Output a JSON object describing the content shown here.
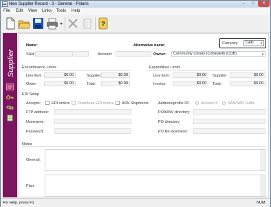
{
  "window": {
    "title": "New Supplier Record - 3 - General - Polaris",
    "min_glyph": "–",
    "max_glyph": "□",
    "close_glyph": "✕"
  },
  "menu": [
    "File",
    "Edit",
    "View",
    "Links",
    "Tools",
    "Help"
  ],
  "toolbar_icons": [
    "new-document-icon",
    "open-folder-icon",
    "save-disk-icon",
    "print-icon",
    "delete-x-icon",
    "copy-icon",
    "help-icon"
  ],
  "sidebar": {
    "title": "Supplier",
    "icons": [
      "supplier-record-icon",
      "key-icon",
      "link-icon",
      "notes-icon"
    ],
    "color": "#7a1560"
  },
  "form": {
    "name_label": "Name:",
    "name_value": "",
    "alt_name_label": "Alternative name:",
    "alt_name_value": "",
    "currency_label": "Currency:",
    "currency_value": "CAD",
    "san_label": "SAN:",
    "san_value": "",
    "san_suffix": "",
    "account_label": "Account:",
    "account_value": "",
    "owner_label": "Owner:",
    "owner_value": "Community Library (Cobleskill) (COB)"
  },
  "encumbrance": {
    "title": "Encumbrance Limits",
    "line_item_label": "Line item:",
    "line_item_value": "$0.00",
    "supplier_label": "Supplier:",
    "supplier_value": "$0.00",
    "order_label": "Order:",
    "order_value": "$0.00",
    "total_label": "Total:",
    "total_value": "$0.00"
  },
  "expenditure": {
    "title": "Expenditure Limits",
    "line_item_label": "Line item:",
    "line_item_value": "$0.00",
    "supplier_label": "Supplier:",
    "supplier_value": "$0.00",
    "invoice_label": "Invoice:",
    "invoice_value": "$0.00",
    "total_label": "Total:",
    "total_value": "$0.00"
  },
  "edi": {
    "title": "EDI Setup",
    "accepts_label": "Accepts:",
    "edi_orders_label": "EDI orders",
    "download_label": "Download EDI orders",
    "asn_label": "ASN Shipments",
    "address_profile_label": "Address/profile ID:",
    "account_option": "Account #",
    "san_option": "SAN/SAN Suffix",
    "ftp_label": "FTP address:",
    "ftp_value": "",
    "username_label": "Username:",
    "username_value": "",
    "password_label": "Password:",
    "password_value": "",
    "poa_dir_label": "POA/INV directory:",
    "poa_dir_value": "",
    "po_dir_label": "PO directory:",
    "po_dir_value": "",
    "po_ext_label": "PO file extension:",
    "po_ext_value": ""
  },
  "notes": {
    "title": "Notes",
    "general_label": "General:",
    "general_value": "",
    "plan_label": "Plan:",
    "plan_value": ""
  },
  "status": {
    "text": "For Help, press F1",
    "num": "NUM"
  }
}
